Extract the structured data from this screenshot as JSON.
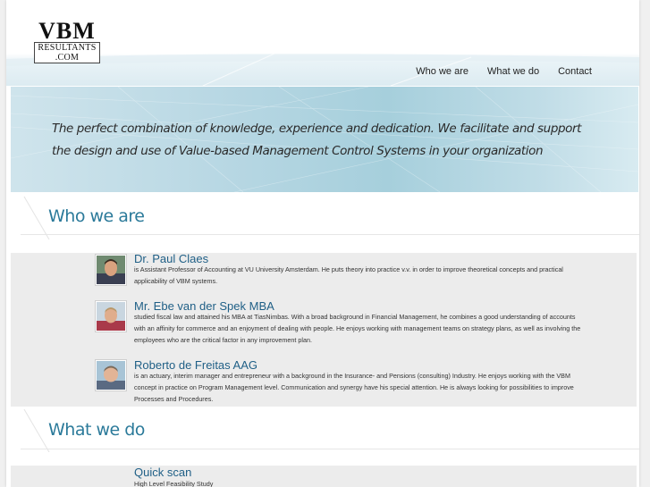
{
  "logo": {
    "main": "VBM",
    "sub1": "RESULTANTS",
    "sub2": ".COM"
  },
  "nav": {
    "items": [
      "Who we are",
      "What we do",
      "Contact"
    ]
  },
  "hero": {
    "line1": "The perfect combination of knowledge, experience and dedication. We facilitate and support",
    "line2": "the design and use of Value-based Management Control Systems in your organization"
  },
  "sections": {
    "who": "Who we are",
    "what": "What we do"
  },
  "people": [
    {
      "name": "Dr. Paul Claes",
      "desc": "is Assistant Professor of Accounting at VU University Amsterdam. He puts theory into practice v.v. in order to improve theoretical concepts and practical applicability of VBM systems."
    },
    {
      "name": "Mr. Ebe van der Spek MBA",
      "desc": "studied fiscal law and attained his MBA at TiasNimbas. With a broad background in Financial Management, he combines a good understanding of accounts with an affinity for commerce and an enjoyment of dealing with people. He enjoys working with management teams on strategy plans, as well as involving the employees who are the critical factor in any improvement plan."
    },
    {
      "name": "Roberto de Freitas AAG",
      "desc": "is an actuary, interim manager and entrepreneur with a background in the Insurance- and Pensions (consulting) Industry. He enjoys working with the VBM concept in practice on Program Management level. Communication and synergy have his special attention. He is always looking for possibilities to improve Processes and Procedures."
    }
  ],
  "services": [
    {
      "name": "Quick scan",
      "desc": "High Level Feasibility Study"
    }
  ],
  "colors": {
    "accent": "#2b7a9a",
    "name": "#1f5f86",
    "hero": "#b7d7e3"
  },
  "icons": [
    "person-photo-1",
    "person-photo-2",
    "person-photo-3"
  ]
}
